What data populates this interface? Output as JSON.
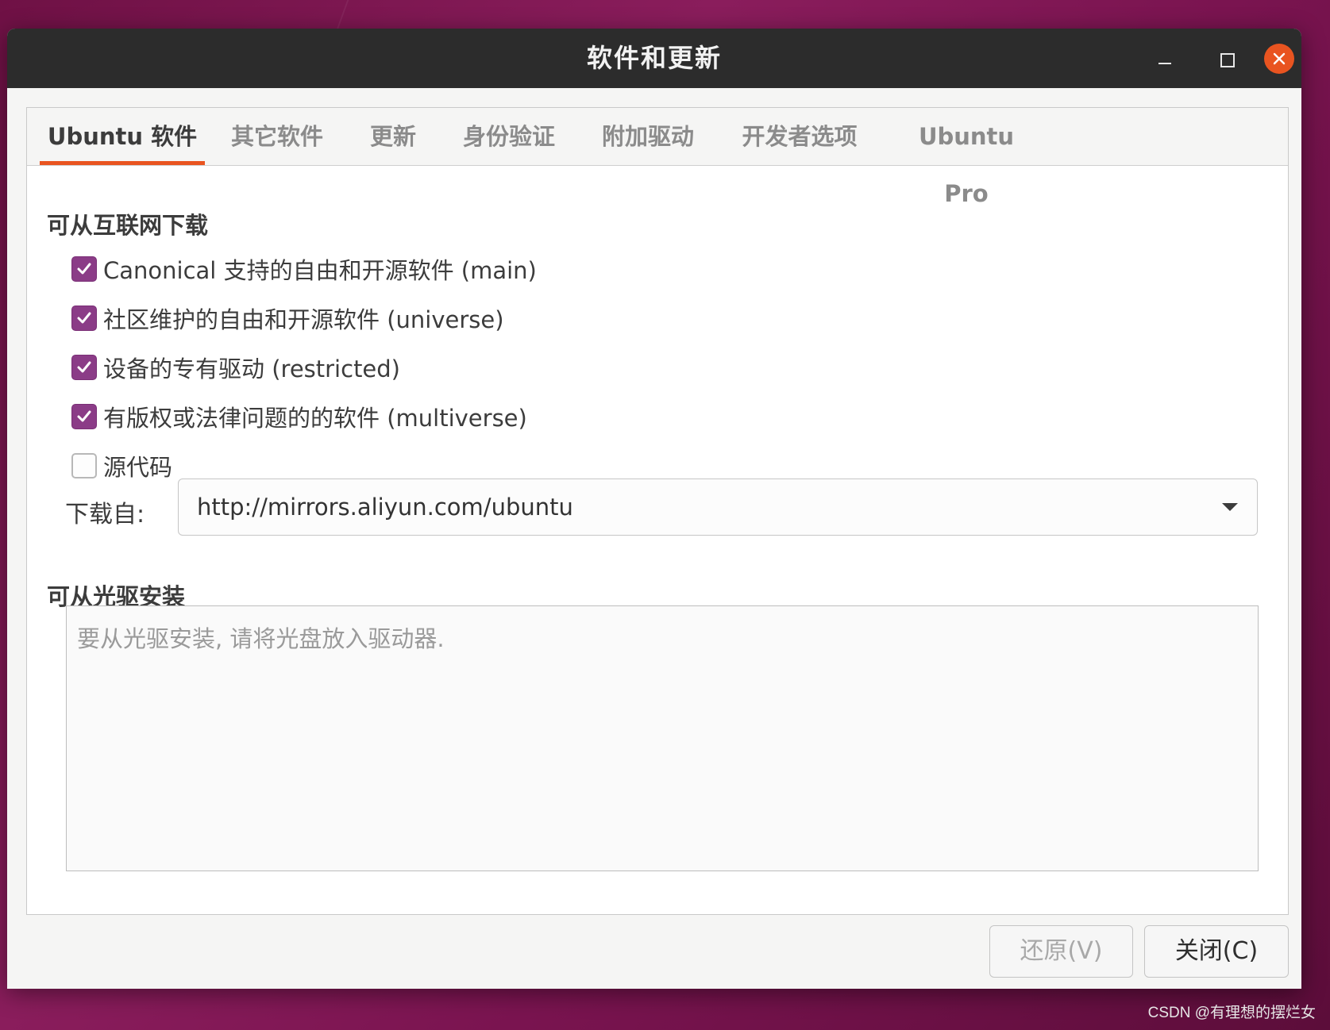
{
  "window": {
    "title": "软件和更新"
  },
  "tabs": [
    {
      "label": "Ubuntu 软件",
      "active": true
    },
    {
      "label": "其它软件",
      "active": false
    },
    {
      "label": "更新",
      "active": false
    },
    {
      "label": "身份验证",
      "active": false
    },
    {
      "label": "附加驱动",
      "active": false
    },
    {
      "label": "开发者选项",
      "active": false
    },
    {
      "label": "Ubuntu Pro",
      "active": false
    }
  ],
  "internet": {
    "heading": "可从互联网下载",
    "options": [
      {
        "label": "Canonical 支持的自由和开源软件 (main)",
        "checked": true
      },
      {
        "label": "社区维护的自由和开源软件 (universe)",
        "checked": true
      },
      {
        "label": "设备的专有驱动 (restricted)",
        "checked": true
      },
      {
        "label": "有版权或法律问题的的软件 (multiverse)",
        "checked": true
      },
      {
        "label": "源代码",
        "checked": false
      }
    ],
    "download_from_label": "下载自:",
    "download_from_value": "http://mirrors.aliyun.com/ubuntu"
  },
  "cdrom": {
    "heading": "可从光驱安装",
    "placeholder": "要从光驱安装, 请将光盘放入驱动器."
  },
  "buttons": {
    "revert": "还原(V)",
    "close": "关闭(C)"
  },
  "watermark": "CSDN @有理想的摆烂女",
  "colors": {
    "accent": "#e95420",
    "checkbox": "#8b3c87",
    "titlebar": "#2c2c2c"
  }
}
